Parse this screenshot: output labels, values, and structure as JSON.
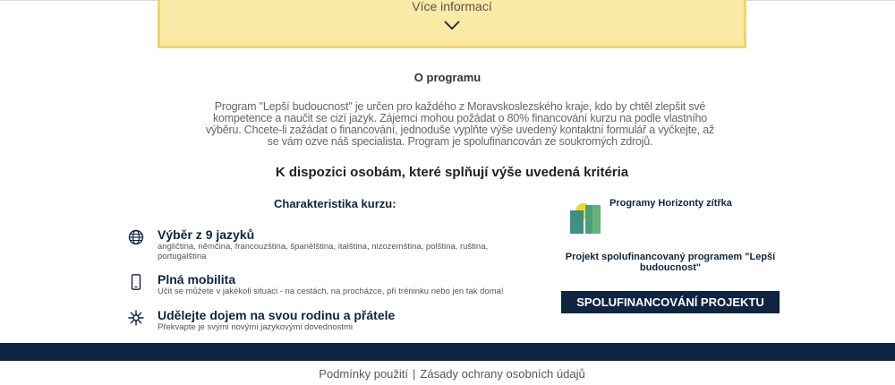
{
  "more_info": {
    "label": "Více informací"
  },
  "about": {
    "title": "O programu",
    "text": "Program \"Lepší budoucnost\" je určen pro každého z Moravskoslezského kraje, kdo by chtěl zlepšit své kompetence a naučit se cizí jazyk. Zájemci mohou požádat o 80% financování kurzu na podle vlastního výběru. Chcete-li zažádat o financování, jednoduše vyplňte výše uvedený kontaktní formulář a vyčkejte, až se vám ozve náš specialista. Program je spolufinancován ze soukromých zdrojů."
  },
  "availability": {
    "title": "K dispozici osobám, které splňují výše uvedená kritéria"
  },
  "course": {
    "title": "Charakteristika kurzu:",
    "features": [
      {
        "icon": "globe-icon",
        "title": "Výběr z 9 jazyků",
        "desc": "angličtina, němčina, francouzština, španělština, italština, nizozemština, polština, ruština, portugalština"
      },
      {
        "icon": "smartphone-icon",
        "title": "Plná mobilita",
        "desc": "Učit se můžete v jakékoli situaci - na cestách, na procházce, při tréninku nebo jen tak doma!"
      },
      {
        "icon": "sparkle-icon",
        "title": "Udělejte dojem na svou rodinu a přátele",
        "desc": "Překvapte je svými novými jazykovými dovednostmi"
      }
    ]
  },
  "sponsor": {
    "name": "Programy Horizonty zítřka",
    "cofinanced_text": "Projekt spolufinancovaný programem \"Lepší budoucnost\"",
    "button_label": "SPOLUFINANCOVÁNÍ PROJEKTU"
  },
  "footer": {
    "terms_label": "Podmínky použití",
    "separator": "|",
    "privacy_label": "Zásady ochrany osobních údajů"
  },
  "colors": {
    "accent_yellow": "#fbe9a6",
    "navy": "#0e2440",
    "logo_yellow": "#f4d33a",
    "logo_teal": "#3f8f83",
    "logo_green": "#64b27a"
  }
}
